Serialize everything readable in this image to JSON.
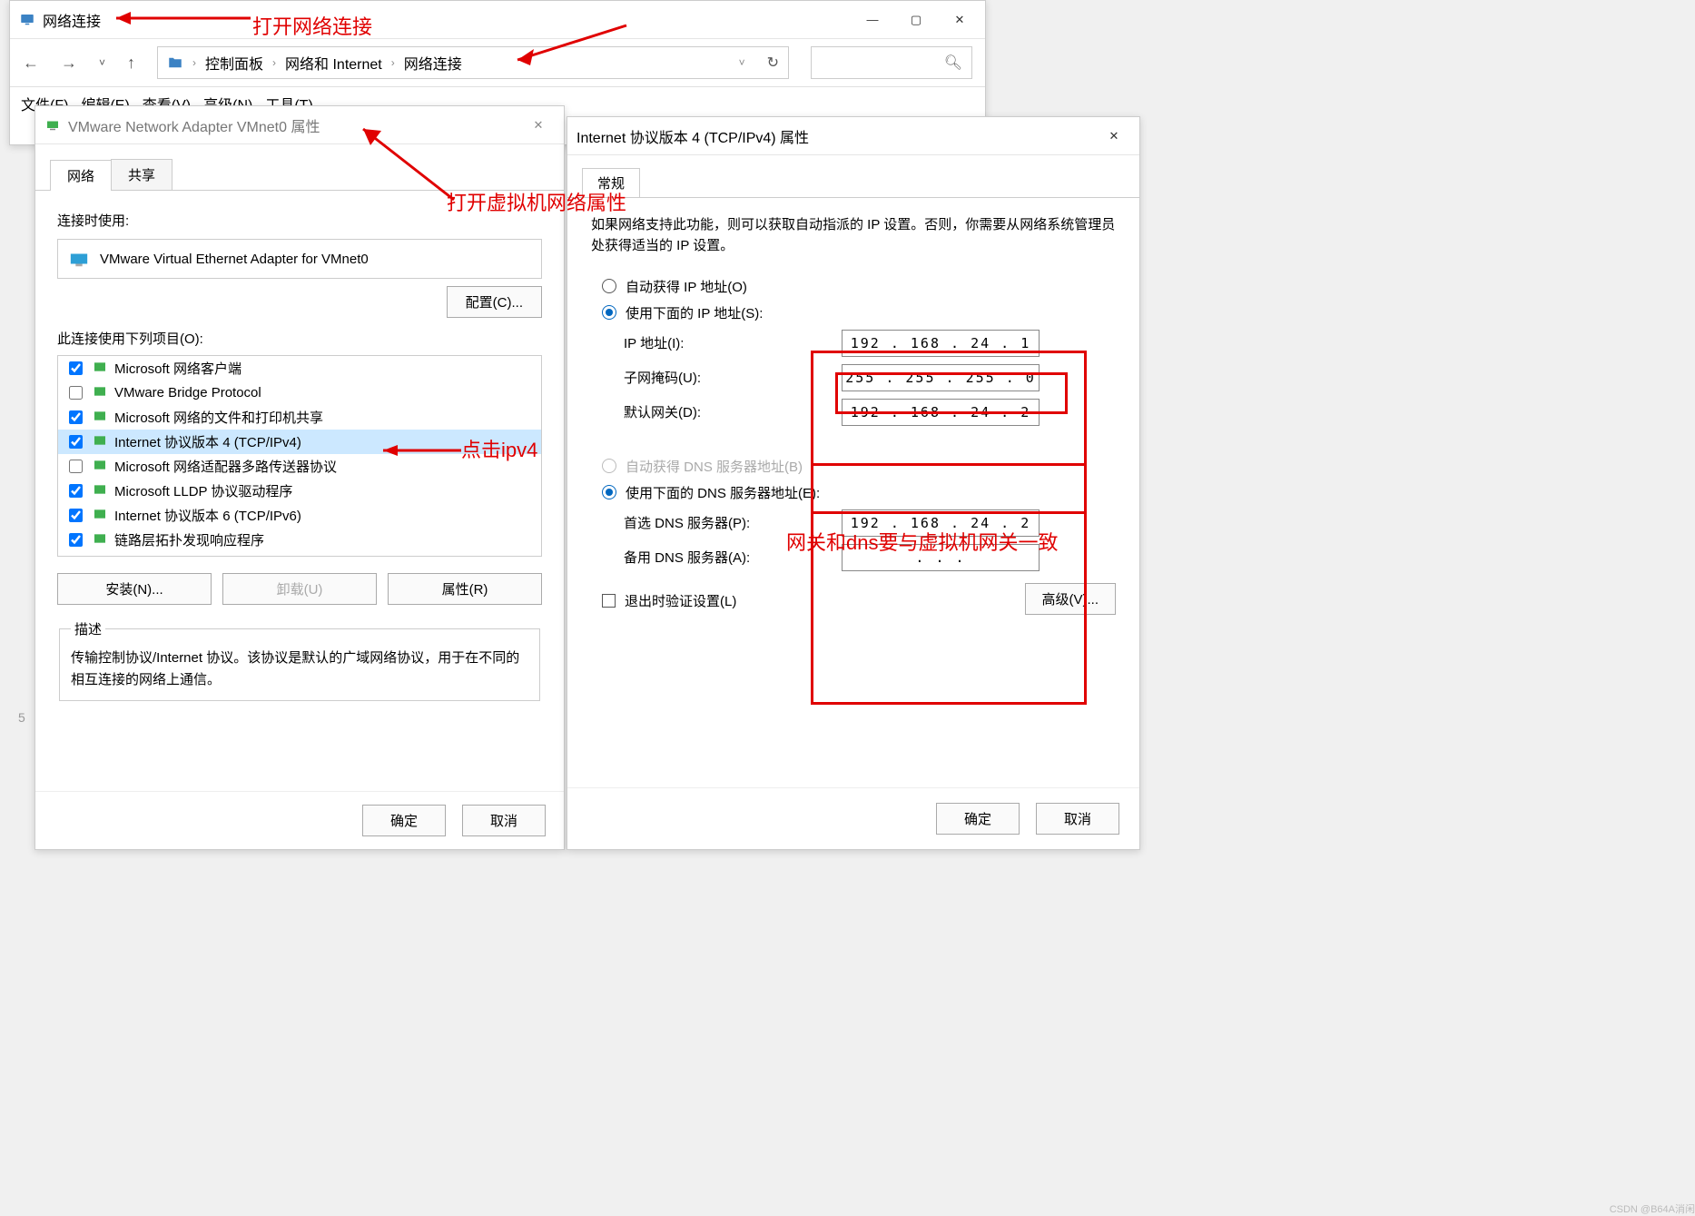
{
  "explorer": {
    "title": "网络连接",
    "breadcrumb": [
      "控制面板",
      "网络和 Internet",
      "网络连接"
    ],
    "menu": [
      "文件(F)",
      "编辑(E)",
      "查看(V)",
      "高级(N)",
      "工具(T)"
    ]
  },
  "props": {
    "title": "VMware Network Adapter VMnet0 属性",
    "tabs": {
      "network": "网络",
      "share": "共享"
    },
    "connect_using": "连接时使用:",
    "adapter": "VMware Virtual Ethernet Adapter for VMnet0",
    "configure_btn": "配置(C)...",
    "use_items_label": "此连接使用下列项目(O):",
    "items": [
      {
        "checked": true,
        "text": "Microsoft 网络客户端"
      },
      {
        "checked": false,
        "text": "VMware Bridge Protocol"
      },
      {
        "checked": true,
        "text": "Microsoft 网络的文件和打印机共享"
      },
      {
        "checked": true,
        "text": "Internet 协议版本 4 (TCP/IPv4)",
        "selected": true
      },
      {
        "checked": false,
        "text": "Microsoft 网络适配器多路传送器协议"
      },
      {
        "checked": true,
        "text": "Microsoft LLDP 协议驱动程序"
      },
      {
        "checked": true,
        "text": "Internet 协议版本 6 (TCP/IPv6)"
      },
      {
        "checked": true,
        "text": "链路层拓扑发现响应程序"
      }
    ],
    "install_btn": "安装(N)...",
    "uninstall_btn": "卸载(U)",
    "properties_btn": "属性(R)",
    "desc_label": "描述",
    "desc_text": "传输控制协议/Internet 协议。该协议是默认的广域网络协议，用于在不同的相互连接的网络上通信。",
    "ok": "确定",
    "cancel": "取消"
  },
  "ipv4": {
    "title": "Internet 协议版本 4 (TCP/IPv4) 属性",
    "tab": "常规",
    "desc": "如果网络支持此功能，则可以获取自动指派的 IP 设置。否则，你需要从网络系统管理员处获得适当的 IP 设置。",
    "auto_ip": "自动获得 IP 地址(O)",
    "use_ip": "使用下面的 IP 地址(S):",
    "ip_label": "IP 地址(I):",
    "ip_value": "192 . 168 .  24  .   1",
    "mask_label": "子网掩码(U):",
    "mask_value": "255 . 255 . 255 .   0",
    "gateway_label": "默认网关(D):",
    "gateway_value": "192 . 168 .  24  .   2",
    "auto_dns": "自动获得 DNS 服务器地址(B)",
    "use_dns": "使用下面的 DNS 服务器地址(E):",
    "dns1_label": "首选 DNS 服务器(P):",
    "dns1_value": "192 . 168 .  24  .   2",
    "dns2_label": "备用 DNS 服务器(A):",
    "dns2_value": ".       .       .",
    "validate": "退出时验证设置(L)",
    "advanced_btn": "高级(V)...",
    "ok": "确定",
    "cancel": "取消"
  },
  "anno": {
    "open_net": "打开网络连接",
    "open_vm_props": "打开虚拟机网络属性",
    "click_ipv4": "点击ipv4",
    "gw_dns": "网关和dns要与虚拟机网关一致"
  },
  "watermark": "CSDN @B64A消闲",
  "background_number": "5"
}
